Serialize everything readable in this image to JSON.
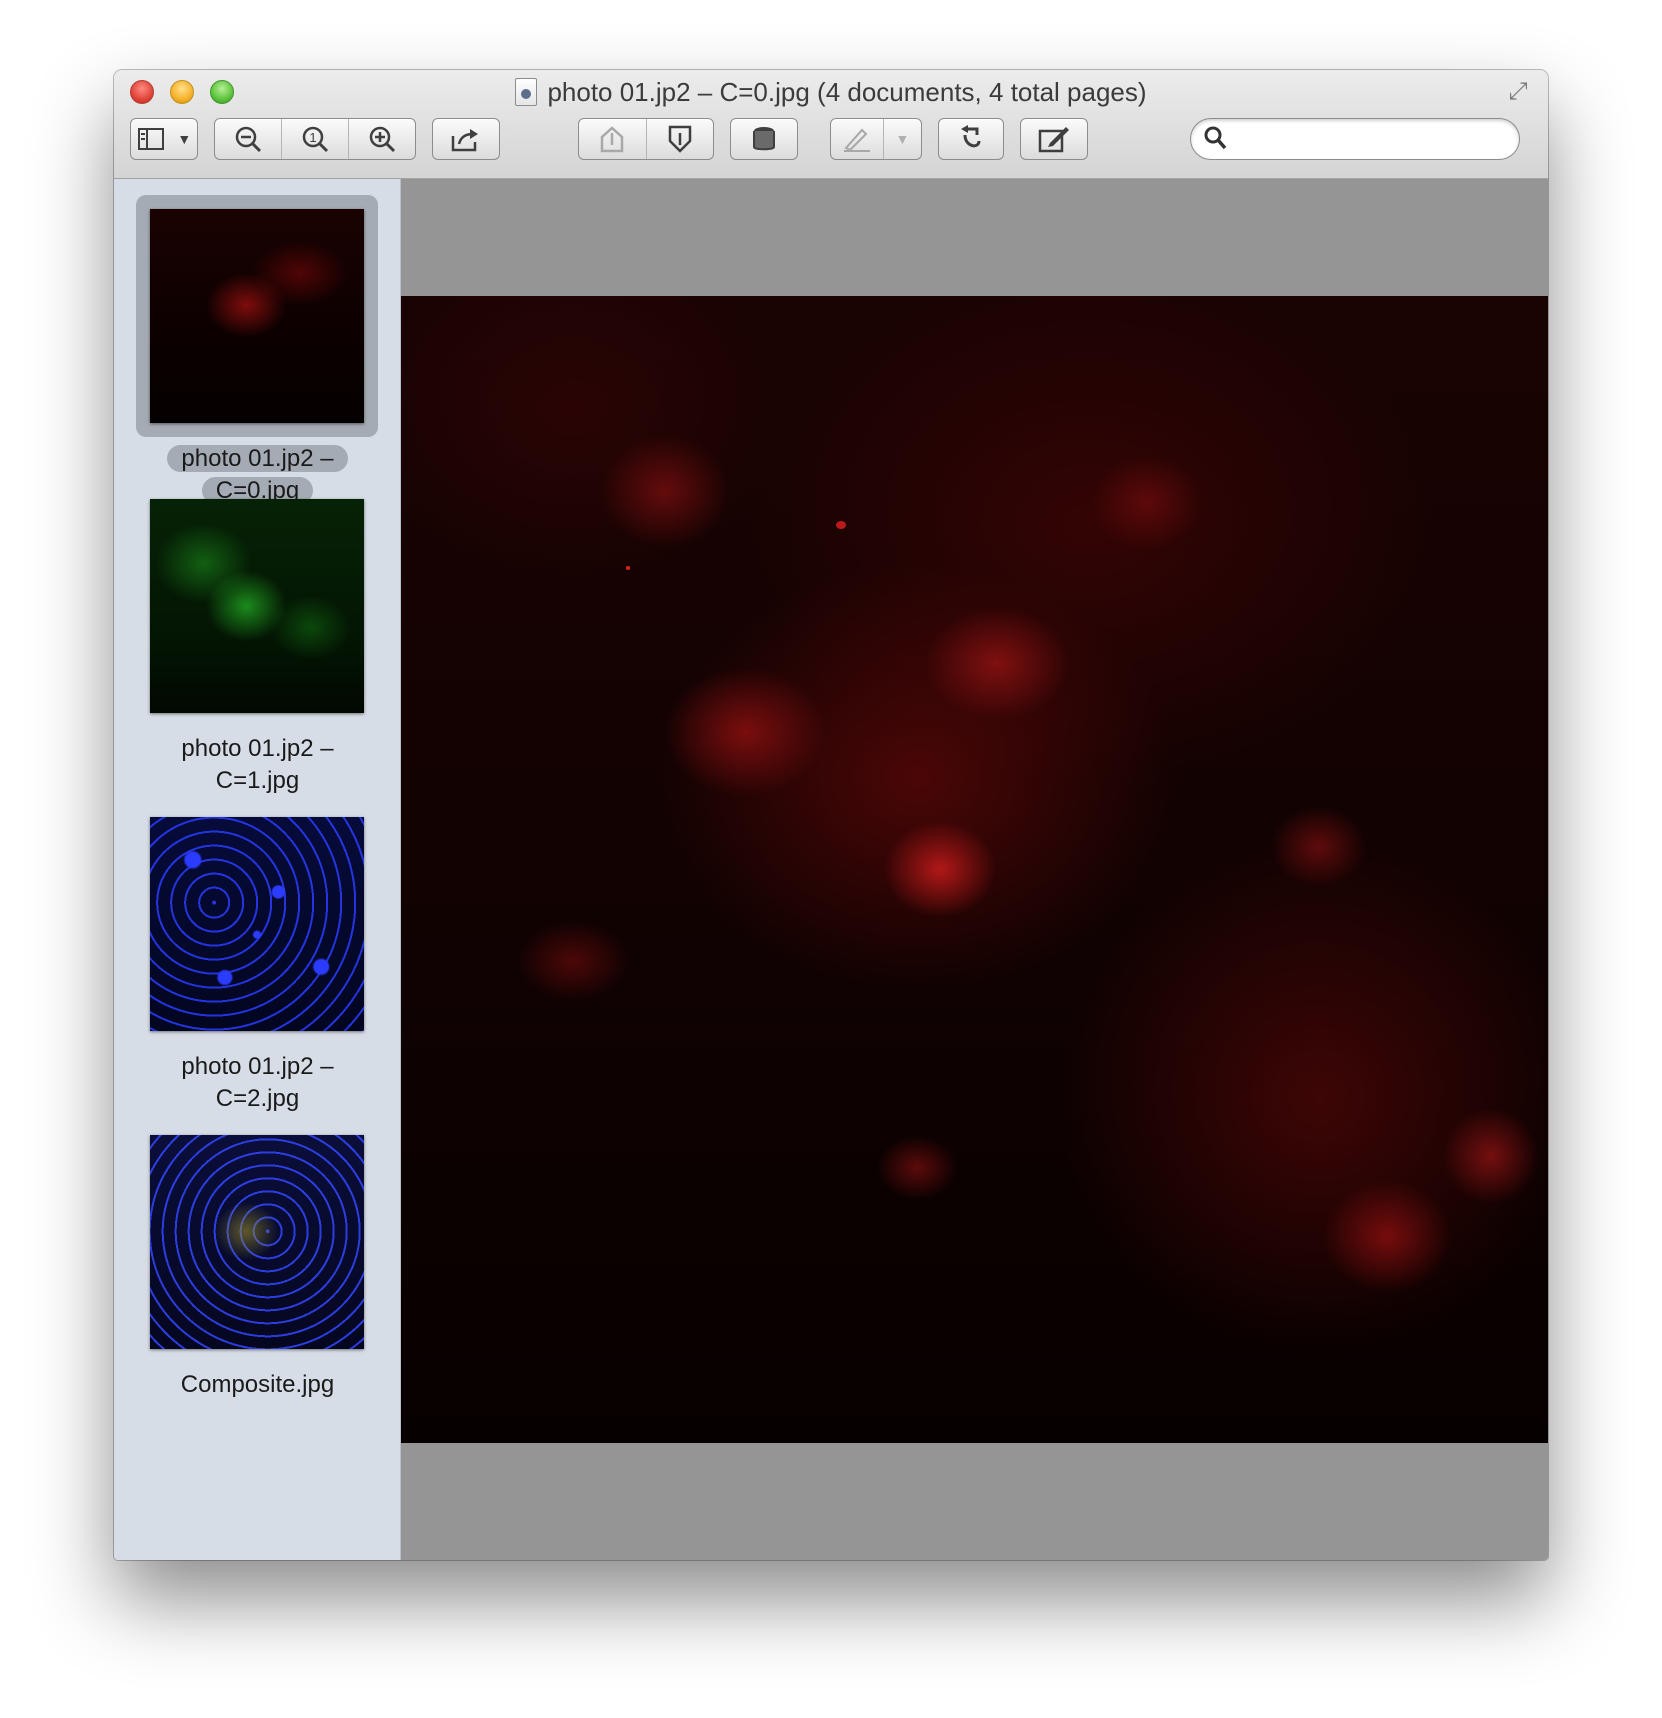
{
  "window": {
    "title": "photo 01.jp2 – C=0.jpg (4 documents, 4 total pages)"
  },
  "toolbar": {
    "view_menu": [
      "sidebar-icon",
      "chevron-down-icon"
    ],
    "zoom": [
      "zoom-out-icon",
      "actual-size-icon",
      "zoom-in-icon"
    ],
    "share": "share-icon",
    "navigation": [
      "previous-page-icon",
      "next-page-icon"
    ],
    "highlight": "highlight-icon",
    "markup": [
      "pen-icon",
      "chevron-down-icon"
    ],
    "rotate": "rotate-icon",
    "annotate": "edit-icon",
    "search_placeholder": ""
  },
  "sidebar": {
    "items": [
      {
        "label_line1": "photo 01.jp2 –",
        "label_line2": "C=0.jpg",
        "channel": "red",
        "selected": true
      },
      {
        "label_line1": "photo 01.jp2 –",
        "label_line2": "C=1.jpg",
        "channel": "green",
        "selected": false
      },
      {
        "label_line1": "photo 01.jp2 –",
        "label_line2": "C=2.jpg",
        "channel": "blue",
        "selected": false
      },
      {
        "label_line1": "Composite.jpg",
        "label_line2": "",
        "channel": "composite",
        "selected": false
      }
    ]
  },
  "colors": {
    "sidebar_bg": "#d7dde6",
    "content_bg": "#959595",
    "selection": "#a5abb4"
  }
}
